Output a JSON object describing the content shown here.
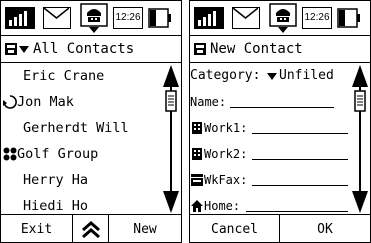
{
  "left_screen": {
    "time": "12:26",
    "header_label": "All Contacts",
    "contacts": [
      {
        "label": "Eric Crane",
        "icon": ""
      },
      {
        "label": "Jon Mak",
        "icon": "call-icon"
      },
      {
        "label": "Gerherdt Will",
        "icon": ""
      },
      {
        "label": "Golf Group",
        "icon": "group-icon"
      },
      {
        "label": "Herry Ha",
        "icon": ""
      },
      {
        "label": "Hiedi Ho",
        "icon": ""
      }
    ],
    "buttons": {
      "exit": "Exit",
      "new": "New"
    }
  },
  "right_screen": {
    "time": "12:26",
    "header_label": "New Contact",
    "category_label": "Category:",
    "category_value": "Unfiled",
    "fields": [
      {
        "label": "Name:",
        "icon": ""
      },
      {
        "label": "Work1:",
        "icon": "building-icon"
      },
      {
        "label": "Work2:",
        "icon": "building-icon"
      },
      {
        "label": "WkFax:",
        "icon": "fax-icon"
      },
      {
        "label": "Home:",
        "icon": "home-icon"
      }
    ],
    "buttons": {
      "cancel": "Cancel",
      "ok": "OK"
    }
  }
}
